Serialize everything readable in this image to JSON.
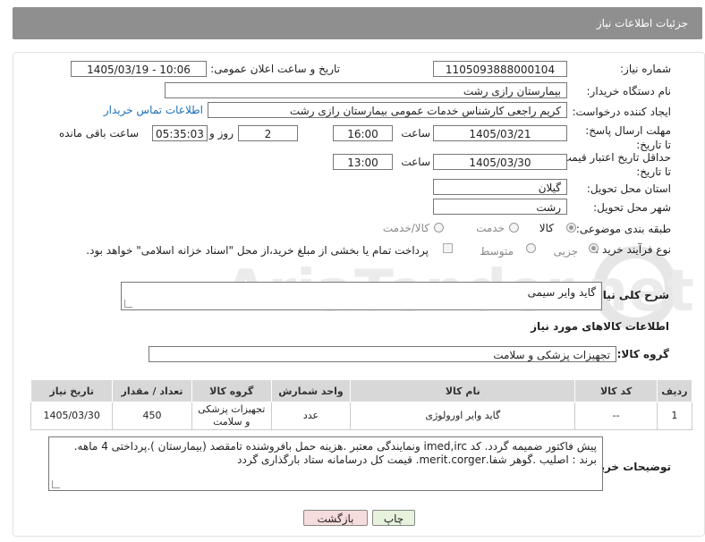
{
  "header": {
    "title": "جزئیات اطلاعات نیاز"
  },
  "fields": {
    "need_number": {
      "label": "شماره نیاز:",
      "value": "1105093888000104"
    },
    "announce": {
      "label": "تاریخ و ساعت اعلان عمومی:",
      "value": "1405/03/19 - 10:06"
    },
    "buyer_org": {
      "label": "نام دستگاه خریدار:",
      "value": "بیمارستان رازی رشت"
    },
    "creator": {
      "label": "ایجاد کننده درخواست:",
      "value": "کریم راجعی کارشناس خدمات عمومی بیمارستان رازی رشت",
      "link": "اطلاعات تماس خریدار"
    },
    "deadline": {
      "label": "مهلت ارسال پاسخ: تا تاریخ:",
      "date": "1405/03/21",
      "time_label": "ساعت",
      "time": "16:00",
      "days": "2",
      "days_label": "روز و",
      "remaining": "05:35:03",
      "remaining_label": "ساعت باقی مانده"
    },
    "validity": {
      "label": "حداقل تاریخ اعتبار قیمت: تا تاریخ:",
      "date": "1405/03/30",
      "time_label": "ساعت",
      "time": "13:00"
    },
    "province": {
      "label": "استان محل تحویل:",
      "value": "گیلان"
    },
    "city": {
      "label": "شهر محل تحویل:",
      "value": "رشت"
    },
    "category": {
      "label": "طبقه بندی موضوعی:",
      "options": [
        "کالا",
        "خدمت",
        "کالا/خدمت"
      ],
      "selected": "کالا"
    },
    "process": {
      "label": "نوع فرآیند خرید :",
      "options": [
        "جزیی",
        "متوسط"
      ],
      "selected": "جزیی",
      "payment_note": "پرداخت تمام یا بخشی از مبلغ خرید،از محل \"اسناد خزانه اسلامی\" خواهد بود."
    }
  },
  "summary": {
    "label": "شرح کلی نیاز:",
    "value": "گاید وایر سیمی"
  },
  "goods_section": {
    "title": "اطلاعات کالاهای مورد نیاز",
    "group_label": "گروه کالا:",
    "group_value": "تجهیزات پزشکی و سلامت"
  },
  "table": {
    "headers": [
      "ردیف",
      "کد کالا",
      "نام کالا",
      "واحد شمارش",
      "گروه کالا",
      "تعداد / مقدار",
      "تاریخ نیاز"
    ],
    "rows": [
      [
        "1",
        "--",
        "گاید وایر اورولوژی",
        "عدد",
        "تجهیزات پزشکی و سلامت",
        "450",
        "1405/03/30"
      ]
    ]
  },
  "notes": {
    "label": "توضیحات خریدار:",
    "value": "پیش فاکتور ضمیمه گردد. کد imed,irc ونمایندگی معتبر .هزینه حمل بافروشنده تامقصد (بیمارستان ).پرداختی 4 ماهه. برند : اصلیب .گوهر شفا.merit.corger. قیمت کل درسامانه ستاد بارگذاری گردد"
  },
  "buttons": {
    "print": "چاپ",
    "back": "بازگشت"
  },
  "colors": {
    "header_bg": "#8f8f8f",
    "link": "#1a6fb5",
    "back_button_bg": "#f6dcdc",
    "print_button_bg": "#e6f2dc",
    "watermark": "#e6e6e6"
  }
}
